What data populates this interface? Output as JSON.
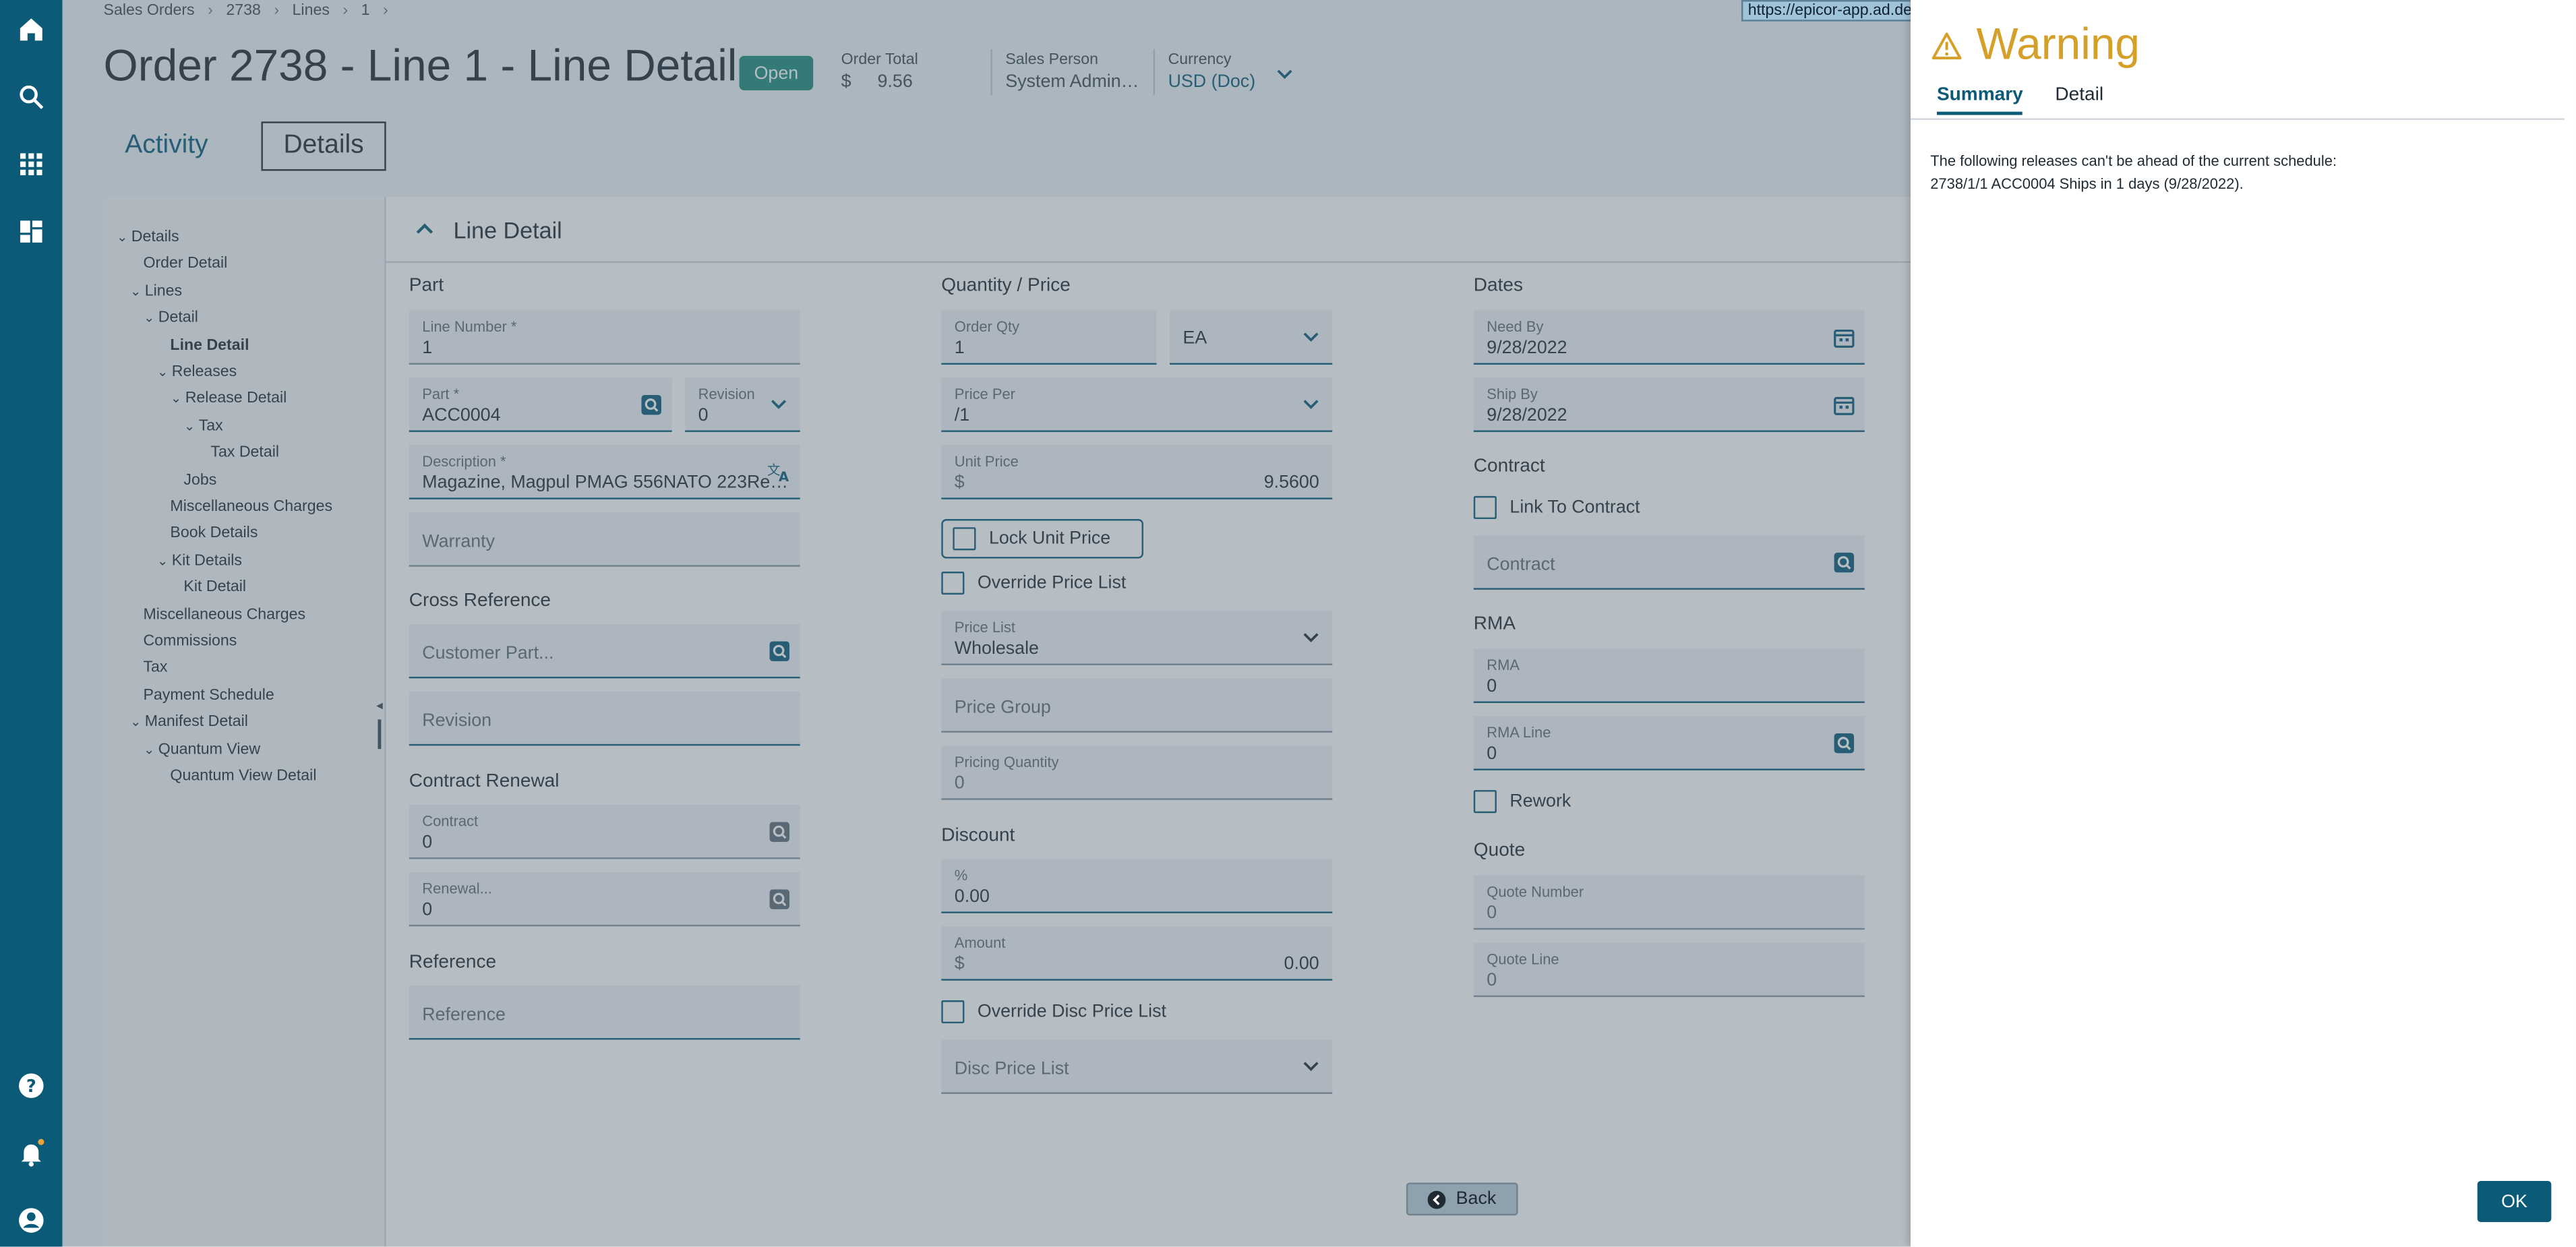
{
  "breadcrumb": [
    "Sales Orders",
    "2738",
    "Lines",
    "1"
  ],
  "page_title": "Order 2738 - Line 1 - Line Detail",
  "status_badge": "Open",
  "header_fields": {
    "order_total": {
      "label": "Order Total",
      "currency_symbol": "$",
      "value": "9.56"
    },
    "sales_person": {
      "label": "Sales Person",
      "value": "System Admin…"
    },
    "currency": {
      "label": "Currency",
      "value": "USD (Doc)"
    }
  },
  "tabs": {
    "activity": "Activity",
    "details": "Details"
  },
  "tree": [
    {
      "label": "Details",
      "depth": 0,
      "expanded": true
    },
    {
      "label": "Order Detail",
      "depth": 1
    },
    {
      "label": "Lines",
      "depth": 1,
      "expanded": true
    },
    {
      "label": "Detail",
      "depth": 2,
      "expanded": true
    },
    {
      "label": "Line Detail",
      "depth": 3,
      "selected": true
    },
    {
      "label": "Releases",
      "depth": 3,
      "expanded": true
    },
    {
      "label": "Release Detail",
      "depth": 4,
      "expanded": true
    },
    {
      "label": "Tax",
      "depth": 5,
      "expanded": true
    },
    {
      "label": "Tax Detail",
      "depth": 6
    },
    {
      "label": "Jobs",
      "depth": 4
    },
    {
      "label": "Miscellaneous Charges",
      "depth": 3
    },
    {
      "label": "Book Details",
      "depth": 3
    },
    {
      "label": "Kit Details",
      "depth": 3,
      "expanded": true
    },
    {
      "label": "Kit Detail",
      "depth": 4
    },
    {
      "label": "Miscellaneous Charges",
      "depth": 1
    },
    {
      "label": "Commissions",
      "depth": 1
    },
    {
      "label": "Tax",
      "depth": 1
    },
    {
      "label": "Payment Schedule",
      "depth": 1
    },
    {
      "label": "Manifest Detail",
      "depth": 1,
      "expanded": true
    },
    {
      "label": "Quantum View",
      "depth": 2,
      "expanded": true
    },
    {
      "label": "Quantum View Detail",
      "depth": 3
    }
  ],
  "section_title": "Line Detail",
  "part_section": {
    "title": "Part",
    "line_number": {
      "label": "Line Number *",
      "value": "1"
    },
    "part": {
      "label": "Part *",
      "value": "ACC0004"
    },
    "revision": {
      "label": "Revision",
      "value": "0"
    },
    "description": {
      "label": "Description *",
      "value": "Magazine, Magpul PMAG 556NATO 223Re…"
    },
    "warranty": {
      "placeholder": "Warranty"
    }
  },
  "cross_reference": {
    "title": "Cross Reference",
    "customer_part": {
      "placeholder": "Customer Part..."
    },
    "revision": {
      "placeholder": "Revision"
    }
  },
  "contract_renewal": {
    "title": "Contract Renewal",
    "contract": {
      "label": "Contract",
      "value": "0"
    },
    "renewal": {
      "label": "Renewal...",
      "value": "0"
    }
  },
  "reference_section": {
    "title": "Reference",
    "reference": {
      "placeholder": "Reference"
    }
  },
  "quantity_price": {
    "title": "Quantity / Price",
    "order_qty": {
      "label": "Order Qty",
      "value": "1"
    },
    "uom": {
      "value": "EA"
    },
    "price_per": {
      "label": "Price Per",
      "value": "/1"
    },
    "unit_price": {
      "label": "Unit Price",
      "currency_symbol": "$",
      "value": "9.5600"
    },
    "lock_unit_price": "Lock Unit Price",
    "override_price_list": "Override Price List",
    "price_list": {
      "label": "Price List",
      "value": "Wholesale"
    },
    "price_group": {
      "placeholder": "Price Group"
    },
    "pricing_quantity": {
      "label": "Pricing Quantity",
      "value": "0"
    }
  },
  "discount": {
    "title": "Discount",
    "percent": {
      "label": "%",
      "value": "0.00"
    },
    "amount": {
      "label": "Amount",
      "currency_symbol": "$",
      "value": "0.00"
    },
    "override_disc_price_list": "Override Disc Price List",
    "disc_price_list": {
      "placeholder": "Disc Price List"
    }
  },
  "dates": {
    "title": "Dates",
    "need_by": {
      "label": "Need By",
      "value": "9/28/2022"
    },
    "ship_by": {
      "label": "Ship By",
      "value": "9/28/2022"
    }
  },
  "contract_section": {
    "title": "Contract",
    "link_to_contract": "Link To Contract",
    "contract": {
      "placeholder": "Contract"
    }
  },
  "rma_section": {
    "title": "RMA",
    "rma": {
      "label": "RMA",
      "value": "0"
    },
    "rma_line": {
      "label": "RMA Line",
      "value": "0"
    },
    "rework": "Rework"
  },
  "quote_section": {
    "title": "Quote",
    "quote_number": {
      "label": "Quote Number",
      "value": "0"
    },
    "quote_line": {
      "label": "Quote Line",
      "value": "0"
    }
  },
  "back_button": "Back",
  "url_tooltip": "https://epicor-app.ad.de",
  "warning_panel": {
    "title": "Warning",
    "tabs": {
      "summary": "Summary",
      "detail": "Detail"
    },
    "message_line1": "The following releases can't be ahead of the current schedule:",
    "message_line2": "2738/1/1 ACC0004 Ships in 1 days (9/28/2022).",
    "ok_button": "OK"
  },
  "colors": {
    "rail": "#0b5a78",
    "accent": "#0b5a78",
    "badge": "#1f8b7a",
    "warning": "#d4a02a"
  }
}
